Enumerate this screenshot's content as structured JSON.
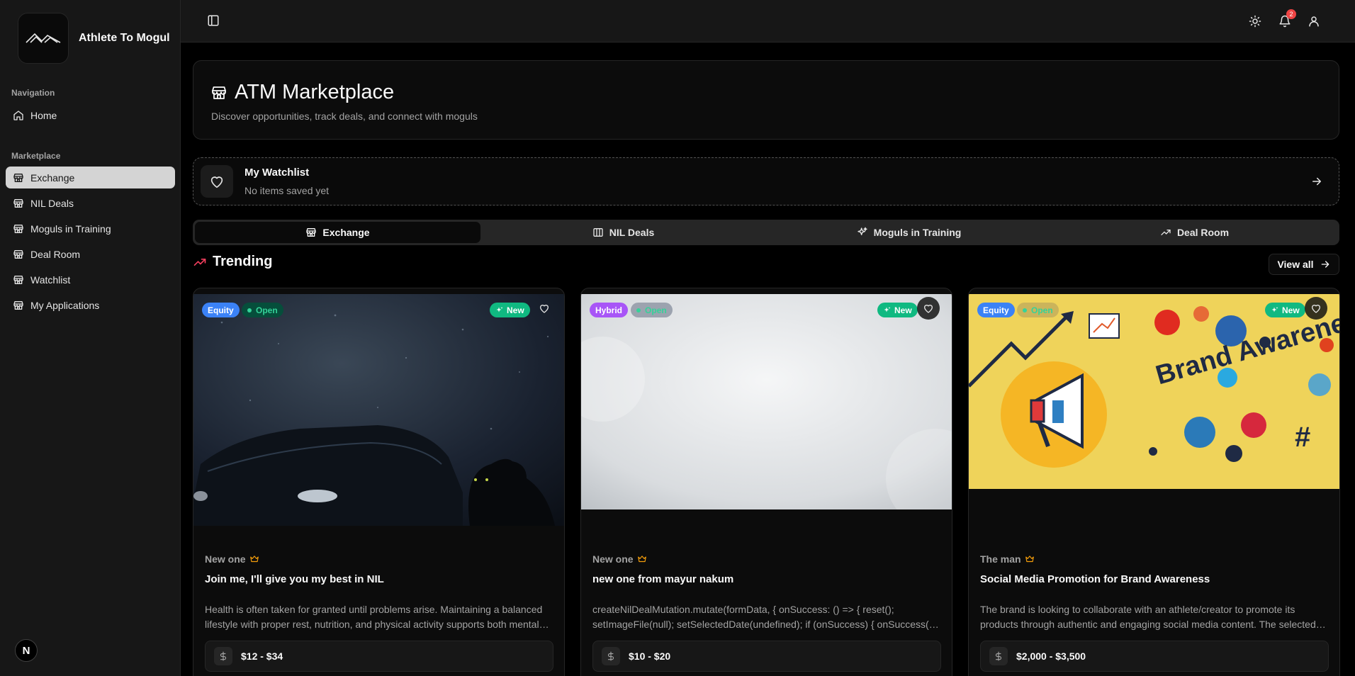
{
  "brand": {
    "name": "Athlete To Mogul"
  },
  "sidebar": {
    "groups": [
      {
        "label": "Navigation",
        "items": [
          {
            "label": "Home",
            "icon": "home-icon"
          }
        ]
      },
      {
        "label": "Marketplace",
        "items": [
          {
            "label": "Exchange",
            "icon": "store-icon",
            "active": true
          },
          {
            "label": "NIL Deals",
            "icon": "store-icon"
          },
          {
            "label": "Moguls in Training",
            "icon": "store-icon"
          },
          {
            "label": "Deal Room",
            "icon": "store-icon"
          },
          {
            "label": "Watchlist",
            "icon": "store-icon"
          },
          {
            "label": "My Applications",
            "icon": "store-icon"
          }
        ]
      }
    ],
    "footer_badge": "N"
  },
  "topbar": {
    "notification_count": "2"
  },
  "header": {
    "title": "ATM Marketplace",
    "subtitle": "Discover opportunities, track deals, and connect with moguls"
  },
  "watchlist": {
    "title": "My Watchlist",
    "subtitle": "No items saved yet"
  },
  "tabs": [
    {
      "label": "Exchange",
      "icon": "store-icon",
      "active": true
    },
    {
      "label": "NIL Deals",
      "icon": "columns-icon"
    },
    {
      "label": "Moguls in Training",
      "icon": "sparkles-icon"
    },
    {
      "label": "Deal Room",
      "icon": "trending-up-icon"
    }
  ],
  "trending": {
    "title": "Trending",
    "view_all": "View all"
  },
  "cards": [
    {
      "type_badge": "Equity",
      "status_badge": "Open",
      "new_badge": "New",
      "author": "New one",
      "title": "Join me, I'll give you my best in NIL",
      "description": "Health is often taken for granted until problems arise. Maintaining a balanced lifestyle with proper rest, nutrition, and physical activity supports both mental and physical wellbeing.",
      "price": "$12 - $34"
    },
    {
      "type_badge": "Hybrid",
      "status_badge": "Open",
      "new_badge": "New",
      "author": "New one",
      "title": "new one from mayur nakum",
      "description": "createNilDealMutation.mutate(formData, { onSuccess: () => { reset(); setImageFile(null); setSelectedDate(undefined); if (onSuccess) { onSuccess(); } } });",
      "price": "$10 - $20"
    },
    {
      "type_badge": "Equity",
      "status_badge": "Open",
      "new_badge": "New",
      "author": "The man",
      "title": "Social Media Promotion for Brand Awareness",
      "description": "The brand is looking to collaborate with an athlete/creator to promote its products through authentic and engaging social media content. The selected creator will share posts.",
      "price": "$2,000 - $3,500",
      "image_text": "Brand Awareness"
    }
  ]
}
